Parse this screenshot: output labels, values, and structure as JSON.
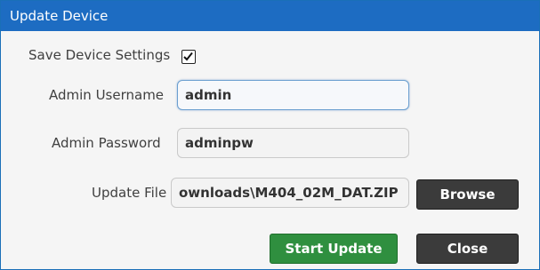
{
  "dialog": {
    "title": "Update Device"
  },
  "form": {
    "save_settings": {
      "label": "Save Device Settings",
      "checked": true
    },
    "username": {
      "label": "Admin Username",
      "value": "admin"
    },
    "password": {
      "label": "Admin Password",
      "value": "adminpw"
    },
    "update_file": {
      "label": "Update File",
      "value": "ownloads\\M404_02M_DAT.ZIP"
    }
  },
  "buttons": {
    "browse": "Browse",
    "start_update": "Start Update",
    "close": "Close"
  },
  "colors": {
    "titlebar": "#1d6cc2",
    "start_update": "#2f8f3f",
    "dark_button": "#3b3b3b"
  }
}
